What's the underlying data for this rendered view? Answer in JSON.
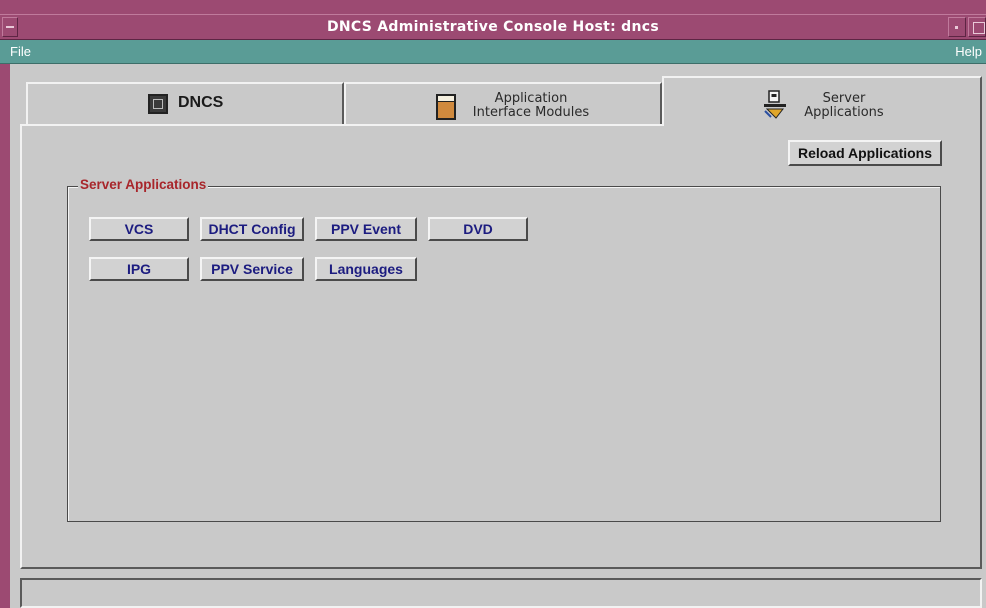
{
  "window": {
    "title": "DNCS Administrative Console   Host: dncs"
  },
  "menubar": {
    "file": "File",
    "help": "Help"
  },
  "tabs": [
    {
      "line1": "DNCS",
      "line2": ""
    },
    {
      "line1": "Application",
      "line2": "Interface Modules"
    },
    {
      "line1": "Server",
      "line2": "Applications"
    }
  ],
  "toolbar": {
    "reload_label": "Reload Applications"
  },
  "group": {
    "title": "Server Applications",
    "buttons": [
      "VCS",
      "DHCT Config",
      "PPV Event",
      "DVD",
      "IPG",
      "PPV Service",
      "Languages"
    ]
  },
  "status": {
    "text": ""
  },
  "colors": {
    "title_bar": "#9c4a72",
    "menu_bar": "#5a9c96",
    "group_title": "#a8262b",
    "button_text": "#1c1c80",
    "panel": "#c9c9c9"
  },
  "icons": {
    "dncs_tab": "monitor-icon",
    "aim_tab": "module-icon",
    "server_tab": "server-app-icon"
  }
}
